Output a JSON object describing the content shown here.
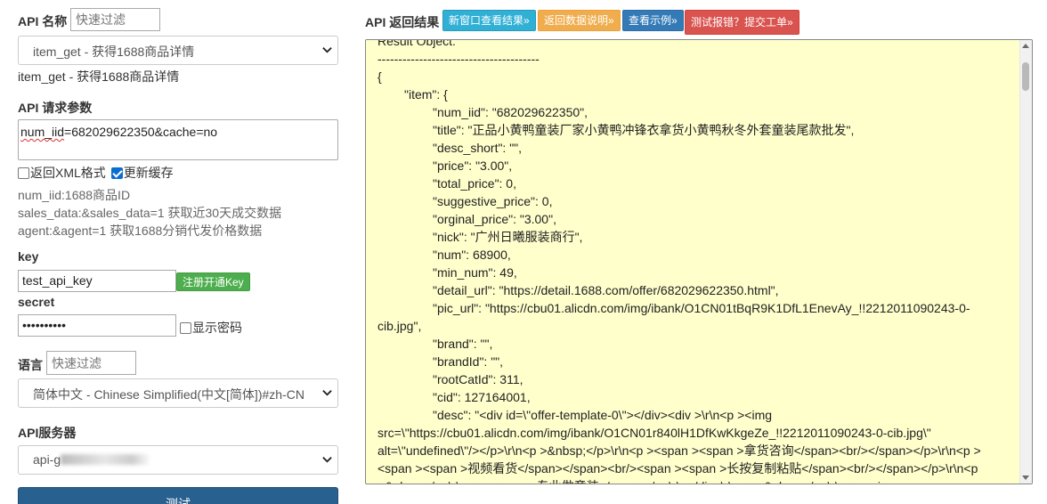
{
  "left": {
    "api_name_label": "API 名称",
    "api_filter_placeholder": "快速过滤",
    "api_select_value": "item_get - 获得1688商品详情",
    "api_desc": "item_get - 获得1688商品详情",
    "params_label": "API 请求参数",
    "params_value_squiggle": "num_iid",
    "params_value_rest": "=682029622350&cache=no",
    "xml_label": "返回XML格式",
    "xml_checked": false,
    "cache_label": "更新缓存",
    "cache_checked": true,
    "help_lines": [
      "num_iid:1688商品ID",
      "sales_data:&sales_data=1 获取近30天成交数据",
      "agent:&agent=1 获取1688分销代发价格数据"
    ],
    "key_label": "key",
    "key_value": "test_api_key",
    "register_button": "注册开通Key",
    "secret_label": "secret",
    "secret_value": "••••••••••",
    "show_password_label": "显示密码",
    "lang_label": "语言",
    "lang_filter_placeholder": "快速过滤",
    "lang_select_value": "简体中文 - Chinese Simplified(中文[简体])#zh-CN",
    "server_label": "API服务器",
    "server_select_value": "api-g",
    "test_button": "测试"
  },
  "right": {
    "title": "API 返回结果",
    "buttons": [
      "新窗口查看结果»",
      "返回数据说明»",
      "查看示例»",
      "测试报错？提交工单»"
    ],
    "result_lines": [
      {
        "indent": 0,
        "text": "Result Object:"
      },
      {
        "indent": 0,
        "text": "---------------------------------------"
      },
      {
        "indent": 0,
        "text": "{"
      },
      {
        "indent": 1,
        "text": "\"item\": {"
      },
      {
        "indent": 2,
        "text": "\"num_iid\": \"682029622350\","
      },
      {
        "indent": 2,
        "text": "\"title\": \"正品小黄鸭童装厂家小黄鸭冲锋衣拿货小黄鸭秋冬外套童装尾款批发\","
      },
      {
        "indent": 2,
        "text": "\"desc_short\": \"\","
      },
      {
        "indent": 2,
        "text": "\"price\": \"3.00\","
      },
      {
        "indent": 2,
        "text": "\"total_price\": 0,"
      },
      {
        "indent": 2,
        "text": "\"suggestive_price\": 0,"
      },
      {
        "indent": 2,
        "text": "\"orginal_price\": \"3.00\","
      },
      {
        "indent": 2,
        "text": "\"nick\": \"广州日曦服装商行\","
      },
      {
        "indent": 2,
        "text": "\"num\": 68900,"
      },
      {
        "indent": 2,
        "text": "\"min_num\": 49,"
      },
      {
        "indent": 2,
        "text": "\"detail_url\": \"https://detail.1688.com/offer/682029622350.html\","
      },
      {
        "indent": 2,
        "text": "\"pic_url\": \"https://cbu01.alicdn.com/img/ibank/O1CN01tBqR9K1DfL1EnevAy_!!2212011090243-0-"
      },
      {
        "indent": 0,
        "text": "cib.jpg\","
      },
      {
        "indent": 2,
        "text": "\"brand\": \"\","
      },
      {
        "indent": 2,
        "text": "\"brandId\": \"\","
      },
      {
        "indent": 2,
        "text": "\"rootCatId\": 311,"
      },
      {
        "indent": 2,
        "text": "\"cid\": 127164001,"
      },
      {
        "indent": 2,
        "text": "\"desc\": \"<div id=\\\"offer-template-0\\\"></div><div >\\r\\n<p ><img"
      },
      {
        "indent": 0,
        "text": "src=\\\"https://cbu01.alicdn.com/img/ibank/O1CN01r840lH1DfKwKkgeZe_!!2212011090243-0-cib.jpg\\\""
      },
      {
        "indent": 0,
        "text": "alt=\\\"undefined\\\"/></p>\\r\\n<p >&nbsp;</p>\\r\\n<p ><span ><span >拿货咨询</span><br/></span></p>\\r\\n<p >"
      },
      {
        "indent": 0,
        "text": "<span ><span >视频看货</span></span><br/><span ><span >长按复制粘贴</span><br/></span></p>\\r\\n<p"
      },
      {
        "indent": 0,
        "text": ">&nbsp;</p>\\r\\n<p ><span >专业做童装</span></p>\\r\\n</div>\\r\\n<p >&nbsp;</p>\\r\\n<p ><img"
      }
    ]
  }
}
